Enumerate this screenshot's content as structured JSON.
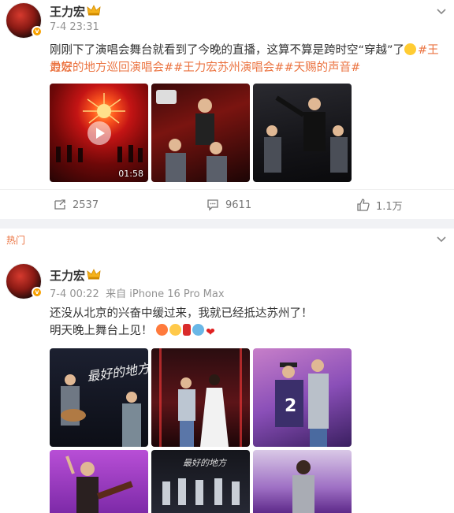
{
  "post1": {
    "username": "王力宏",
    "time": "7-4 23:31",
    "text_plain": "刚刚下了演唱会舞台就看到了今晚的直播，这算不算是跨时空“穿越”了",
    "tags_line1": "#王力宏",
    "tags_line2_a": "最好的地方巡回演唱会#",
    "tags_line2_b": "#王力宏苏州演唱会#",
    "tags_line2_c": "#天赐的声音#",
    "video_duration": "01:58",
    "actions": {
      "repost": "2537",
      "comment": "9611",
      "like": "1.1万"
    }
  },
  "post2": {
    "hot_label": "热门",
    "username": "王力宏",
    "time": "7-4 00:22",
    "source": "来自 iPhone 16 Pro Max",
    "text_line1": "还没从北京的兴奋中缓过来，我就已经抵达苏州了！",
    "text_line2": "明天晚上舞台上见！",
    "images": {
      "calligraphy": "最好的地方",
      "calligraphy2": "最好的地方",
      "jersey_number": "2"
    }
  },
  "colors": {
    "tag": "#eb7340",
    "meta": "#939393",
    "badge": "#f7a100"
  }
}
